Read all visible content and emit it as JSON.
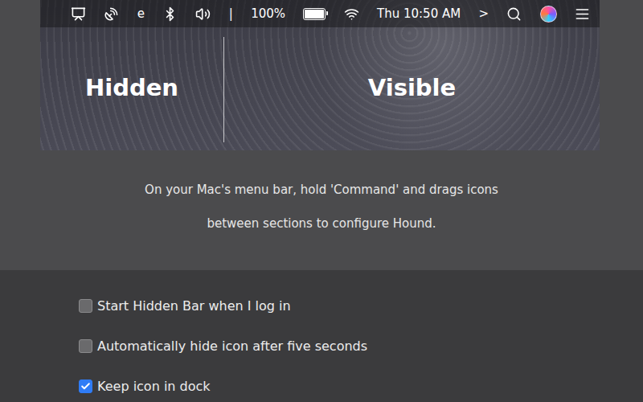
{
  "menubar": {
    "items": [
      {
        "kind": "icon"
      },
      {
        "kind": "icon"
      },
      {
        "kind": "text",
        "label": "e"
      },
      {
        "kind": "icon"
      },
      {
        "kind": "icon"
      },
      {
        "kind": "text",
        "label": "|"
      },
      {
        "kind": "text",
        "label": "100%"
      },
      {
        "kind": "battery",
        "level": 1
      },
      {
        "kind": "icon"
      },
      {
        "kind": "text",
        "label": "Thu 10:50 AM"
      },
      {
        "kind": "text",
        "label": ">"
      },
      {
        "kind": "icon"
      },
      {
        "kind": "siri"
      },
      {
        "kind": "icon"
      }
    ]
  },
  "banner": {
    "hidden_label": "Hidden",
    "visible_label": "Visible"
  },
  "instructions": [
    "On your Mac's menu bar, hold 'Command' and drags icons",
    "between sections to configure Hound."
  ],
  "options": [
    {
      "label": "Start Hidden Bar when I log in",
      "checked": false
    },
    {
      "label": "Automatically hide icon after five seconds",
      "checked": false
    },
    {
      "label": "Keep icon in dock",
      "checked": true
    }
  ]
}
